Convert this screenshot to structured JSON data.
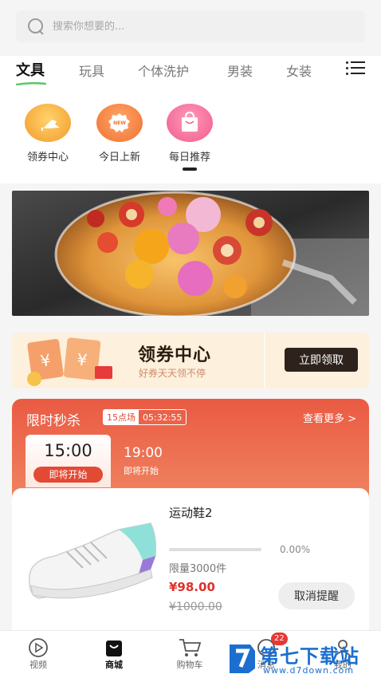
{
  "search": {
    "placeholder": "搜索你想要的..."
  },
  "tabs": [
    {
      "label": "文具",
      "active": true
    },
    {
      "label": "玩具"
    },
    {
      "label": "个体洗护"
    },
    {
      "label": "男装"
    },
    {
      "label": "女装"
    }
  ],
  "categories": [
    {
      "label": "领券中心",
      "icon": "shoe-icon"
    },
    {
      "label": "今日上新",
      "icon": "new-badge-icon"
    },
    {
      "label": "每日推荐",
      "icon": "shopping-bag-icon"
    }
  ],
  "coupon": {
    "title": "领券中心",
    "subtitle": "好券天天领不停",
    "button": "立即领取"
  },
  "flash_sale": {
    "title": "限时秒杀",
    "session_label": "15点场",
    "countdown": "05:32:55",
    "more": "查看更多 >",
    "slots": [
      {
        "time": "15:00",
        "status": "即将开始",
        "active": true
      },
      {
        "time": "19:00",
        "status": "即将开始"
      }
    ],
    "product": {
      "name": "运动鞋2",
      "progress_text": "0.00%",
      "progress": 0,
      "limit": "限量3000件",
      "price": "¥98.00",
      "original_price": "¥1000.00",
      "button": "取消提醒"
    }
  },
  "nav": [
    {
      "label": "视频",
      "icon": "video-play-icon"
    },
    {
      "label": "商城",
      "icon": "shop-bag-icon",
      "active": true
    },
    {
      "label": "购物车",
      "icon": "cart-icon"
    },
    {
      "label": "消息",
      "icon": "message-icon",
      "badge": "22"
    },
    {
      "label": "我的",
      "icon": "user-icon"
    }
  ],
  "watermark": {
    "title": "第七下载站",
    "url": "www.d7down.com"
  },
  "colors": {
    "accent": "#e24a34",
    "price": "#e0302a",
    "coupon_bg": "#fdf0dc"
  }
}
